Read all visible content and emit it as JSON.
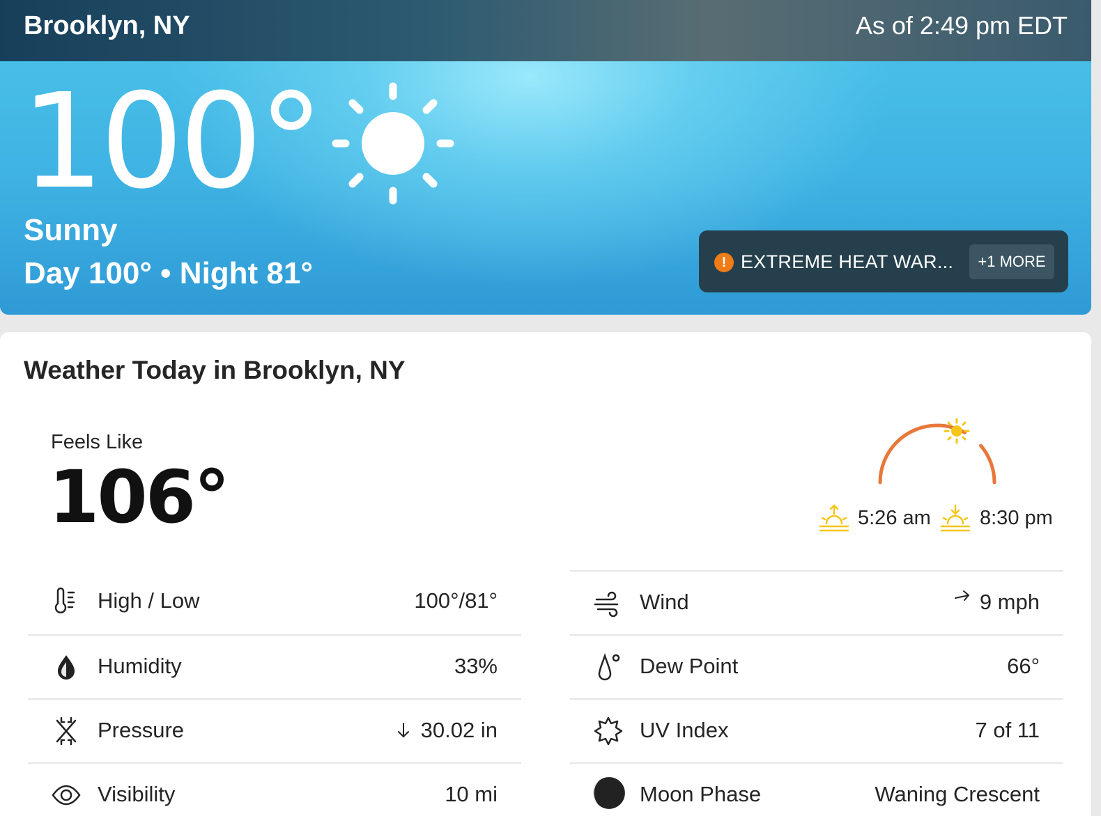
{
  "header": {
    "location": "Brooklyn, NY",
    "as_of": "As of 2:49 pm EDT"
  },
  "current": {
    "temperature": "100°",
    "phrase": "Sunny",
    "day_night": "Day 100° • Night 81°",
    "icon": "sun-icon"
  },
  "alert": {
    "text": "EXTREME HEAT WAR...",
    "more_label": "+1 MORE",
    "icon": "exclamation-icon",
    "color": "#f07c17"
  },
  "details": {
    "title": "Weather Today in Brooklyn, NY",
    "feels_like_label": "Feels Like",
    "feels_like_value": "106°",
    "sunrise": "5:26 am",
    "sunset": "8:30 pm",
    "left_rows": [
      {
        "label": "High / Low",
        "value": "100°/81°",
        "icon": "thermometer-icon"
      },
      {
        "label": "Humidity",
        "value": "33%",
        "icon": "droplet-icon"
      },
      {
        "label": "Pressure",
        "value": "30.02 in",
        "icon": "pressure-icon",
        "arrow": "down"
      },
      {
        "label": "Visibility",
        "value": "10 mi",
        "icon": "eye-icon"
      }
    ],
    "right_rows": [
      {
        "label": "Wind",
        "value": "9 mph",
        "icon": "wind-icon",
        "arrow": "right"
      },
      {
        "label": "Dew Point",
        "value": "66°",
        "icon": "dewpoint-icon"
      },
      {
        "label": "UV Index",
        "value": "7 of 11",
        "icon": "uv-icon"
      },
      {
        "label": "Moon Phase",
        "value": "Waning Crescent",
        "icon": "moon-icon"
      }
    ]
  },
  "colors": {
    "sun_arc": "#e8773a",
    "sun_yellow": "#f5c518",
    "alert_bg": "#253f4c"
  }
}
